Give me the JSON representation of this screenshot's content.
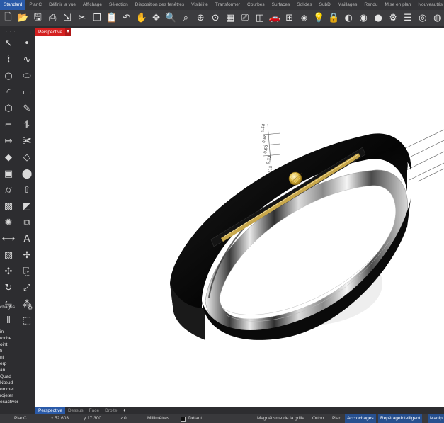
{
  "tabs": [
    {
      "label": "Standard",
      "active": true
    },
    {
      "label": "PlanC"
    },
    {
      "label": "Définir la vue"
    },
    {
      "label": "Affichage"
    },
    {
      "label": "Sélection"
    },
    {
      "label": "Disposition des fenêtres"
    },
    {
      "label": "Visibilité"
    },
    {
      "label": "Transformer"
    },
    {
      "label": "Courbes"
    },
    {
      "label": "Surfaces"
    },
    {
      "label": "Solides"
    },
    {
      "label": "SubD"
    },
    {
      "label": "Maillages"
    },
    {
      "label": "Rendu"
    },
    {
      "label": "Mise en plan"
    },
    {
      "label": "Nouveautés dans"
    }
  ],
  "toolbar_icons": [
    {
      "name": "new-icon",
      "glyph": "🗋"
    },
    {
      "name": "open-icon",
      "glyph": "📂"
    },
    {
      "name": "save-icon",
      "glyph": "🖫"
    },
    {
      "name": "print-icon",
      "glyph": "⎙"
    },
    {
      "name": "import-icon",
      "glyph": "⇲"
    },
    {
      "name": "cut-icon",
      "glyph": "✂"
    },
    {
      "name": "copy-icon",
      "glyph": "❐"
    },
    {
      "name": "paste-icon",
      "glyph": "📋"
    },
    {
      "name": "undo-icon",
      "glyph": "↶"
    },
    {
      "name": "pan-hand-icon",
      "glyph": "✋"
    },
    {
      "name": "rotate-view-icon",
      "glyph": "✥"
    },
    {
      "name": "zoom-icon",
      "glyph": "🔍"
    },
    {
      "name": "zoom-window-icon",
      "glyph": "⌕"
    },
    {
      "name": "zoom-extents-icon",
      "glyph": "⊕"
    },
    {
      "name": "zoom-selected-icon",
      "glyph": "⊙"
    },
    {
      "name": "viewport-layout-icon",
      "glyph": "▦"
    },
    {
      "name": "named-view-icon",
      "glyph": "⎚"
    },
    {
      "name": "camera-icon",
      "glyph": "◫"
    },
    {
      "name": "car-icon",
      "glyph": "🚗"
    },
    {
      "name": "cplane-icon",
      "glyph": "⊞"
    },
    {
      "name": "layer-icon",
      "glyph": "◈"
    },
    {
      "name": "light-icon",
      "glyph": "💡"
    },
    {
      "name": "lock-icon",
      "glyph": "🔒"
    },
    {
      "name": "shaded-icon",
      "glyph": "◐"
    },
    {
      "name": "color-wheel-icon",
      "glyph": "◉"
    },
    {
      "name": "sphere-icon",
      "glyph": "●"
    },
    {
      "name": "properties-icon",
      "glyph": "⚙"
    },
    {
      "name": "options-icon",
      "glyph": "☰"
    },
    {
      "name": "rendered-icon",
      "glyph": "◎"
    },
    {
      "name": "material-icon",
      "glyph": "◍"
    }
  ],
  "sidebar_icons": [
    {
      "name": "select-icon",
      "glyph": "↖"
    },
    {
      "name": "point-icon",
      "glyph": "•"
    },
    {
      "name": "polyline-icon",
      "glyph": "⌇"
    },
    {
      "name": "curve-icon",
      "glyph": "∿"
    },
    {
      "name": "circle-icon",
      "glyph": "○"
    },
    {
      "name": "ellipse-icon",
      "glyph": "⬭"
    },
    {
      "name": "arc-icon",
      "glyph": "◜"
    },
    {
      "name": "rectangle-icon",
      "glyph": "▭"
    },
    {
      "name": "polygon-icon",
      "glyph": "⬡"
    },
    {
      "name": "freeform-icon",
      "glyph": "✎"
    },
    {
      "name": "fillet-icon",
      "glyph": "⌐"
    },
    {
      "name": "offset-icon",
      "glyph": "⥮"
    },
    {
      "name": "extend-icon",
      "glyph": "↦"
    },
    {
      "name": "trim-icon",
      "glyph": "✀"
    },
    {
      "name": "surface-icon",
      "glyph": "◆"
    },
    {
      "name": "loft-icon",
      "glyph": "◇"
    },
    {
      "name": "box-icon",
      "glyph": "▣"
    },
    {
      "name": "sphere-solid-icon",
      "glyph": "⬤"
    },
    {
      "name": "cylinder-icon",
      "glyph": "⌭"
    },
    {
      "name": "extrude-icon",
      "glyph": "⇧"
    },
    {
      "name": "mesh-icon",
      "glyph": "▩"
    },
    {
      "name": "boolean-icon",
      "glyph": "◩"
    },
    {
      "name": "explode-icon",
      "glyph": "✺"
    },
    {
      "name": "join-icon",
      "glyph": "⧉"
    },
    {
      "name": "dimension-icon",
      "glyph": "⟷"
    },
    {
      "name": "text-icon",
      "glyph": "A"
    },
    {
      "name": "hatch-icon",
      "glyph": "▨"
    },
    {
      "name": "gumball-icon",
      "glyph": "✢"
    },
    {
      "name": "move-icon",
      "glyph": "✣"
    },
    {
      "name": "copy-obj-icon",
      "glyph": "⎘"
    },
    {
      "name": "rotate-icon",
      "glyph": "↻"
    },
    {
      "name": "scale-icon",
      "glyph": "⤢"
    },
    {
      "name": "mirror-icon",
      "glyph": "⇋"
    },
    {
      "name": "array-icon",
      "glyph": "⁂"
    },
    {
      "name": "align-icon",
      "glyph": "⫴"
    },
    {
      "name": "group-icon",
      "glyph": "⬚"
    }
  ],
  "osnap": {
    "header": "chages",
    "items": [
      "in",
      "roche",
      "oint",
      "ﬁ",
      "nt",
      "erp",
      "an",
      "Quad",
      "Nœud",
      "ommet",
      "rojeter",
      "ésactiver"
    ]
  },
  "viewport": {
    "label": "Perspective"
  },
  "viewport_tabs": [
    {
      "label": "Perspective",
      "active": true
    },
    {
      "label": "Dessus"
    },
    {
      "label": "Face"
    },
    {
      "label": "Droite"
    },
    {
      "label": "+"
    }
  ],
  "status": {
    "cplane": "PlanC",
    "x": "x 52.603",
    "y": "y 17.300",
    "z": "z 0",
    "units": "Millimètres",
    "layer": "Défaut",
    "grid_snap": "Magnétisme de la grille",
    "ortho": "Ortho",
    "planar": "Plan",
    "osnap": "Accrochages",
    "smarttrack": "RepérageIntelligent",
    "gumball": "Manip"
  },
  "annotations": [
    "0.50",
    "0.88",
    "0.65",
    "0.33",
    "0.15"
  ],
  "colors": {
    "accent": "#2a5aa8",
    "viewport_label": "#d42020",
    "ring_black": "#0b0b0b",
    "gold": "#c9a84b"
  }
}
